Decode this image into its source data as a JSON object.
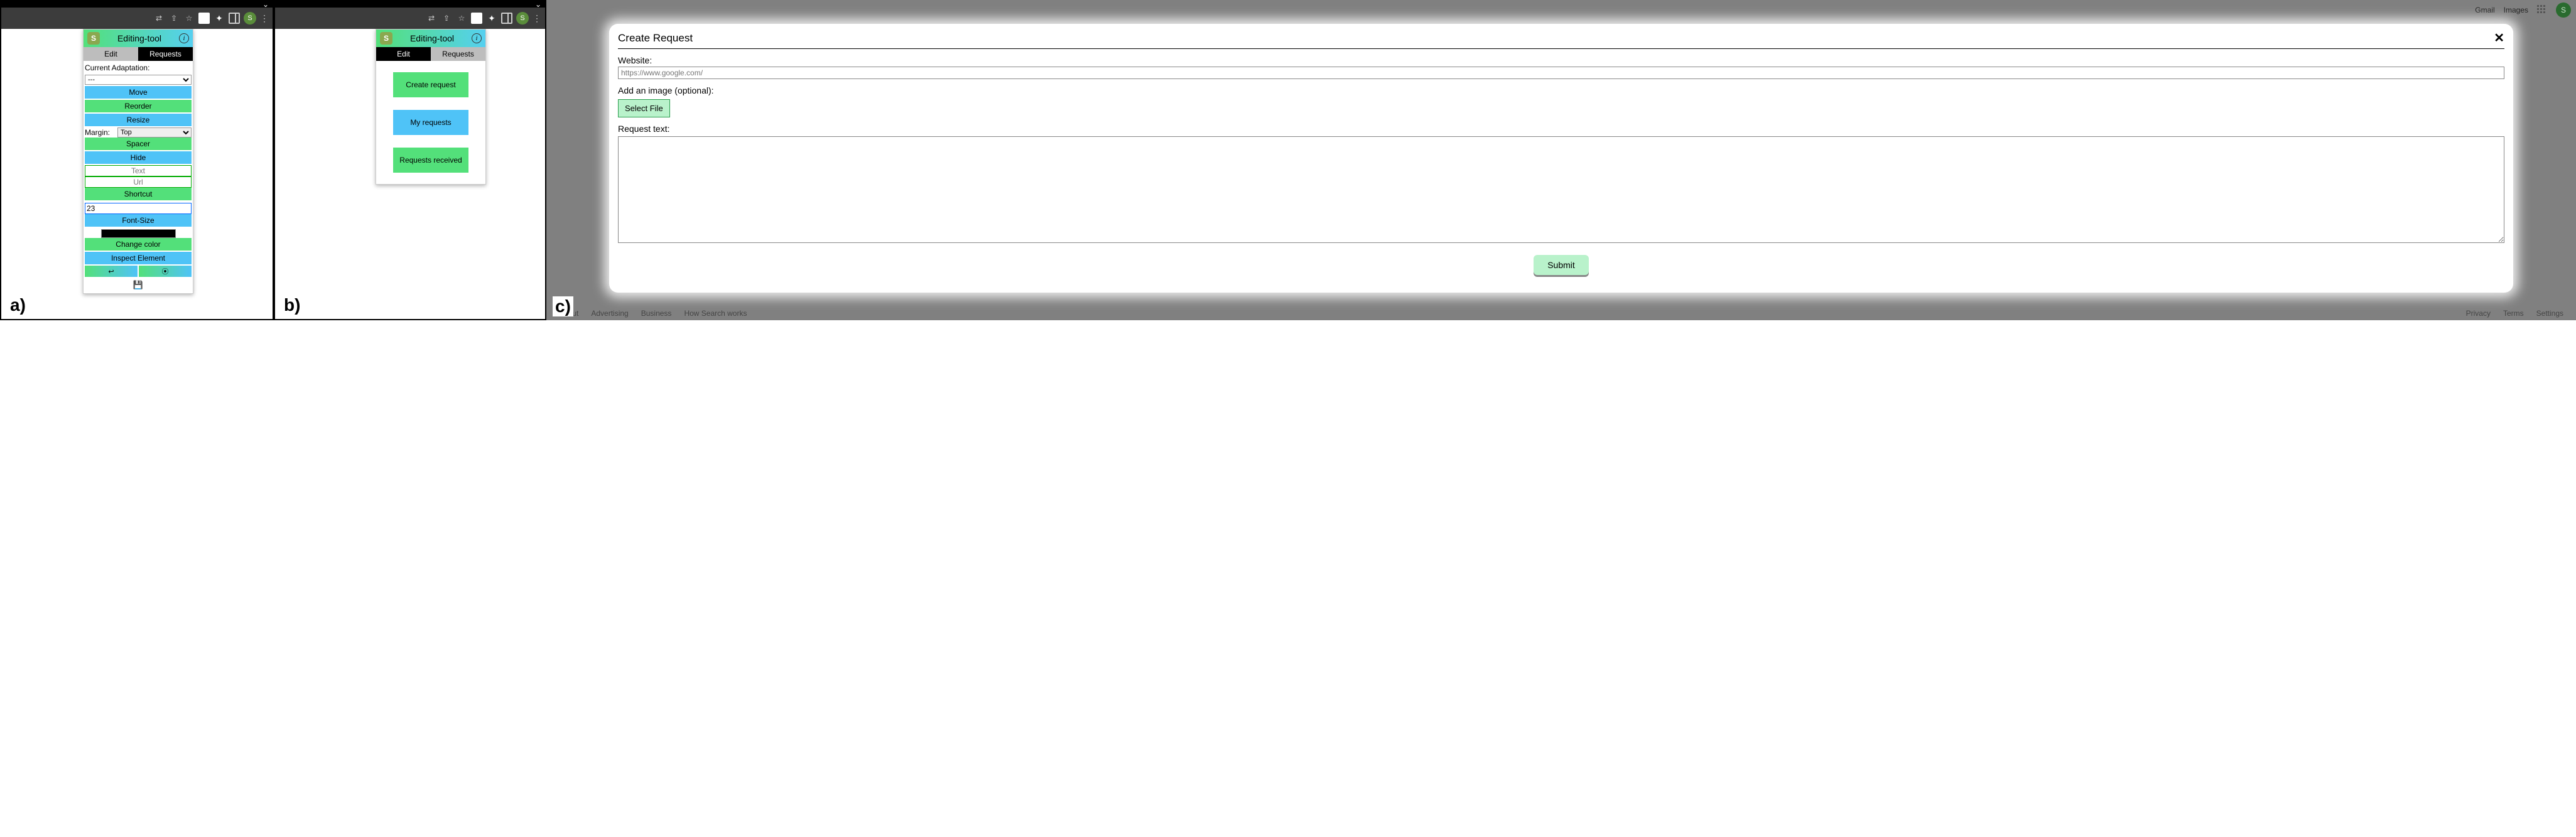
{
  "figure_labels": {
    "a": "a)",
    "b": "b)",
    "c": "c)"
  },
  "chrome": {
    "avatar_letter": "S"
  },
  "extension": {
    "logo_letter": "S",
    "title": "Editing-tool",
    "tabs": {
      "edit": "Edit",
      "requests": "Requests"
    }
  },
  "panel_a": {
    "active_tab": "requests",
    "current_adaptation_label": "Current Adaptation:",
    "current_adaptation_value": "---",
    "buttons": {
      "move": "Move",
      "reorder": "Reorder",
      "resize": "Resize",
      "spacer": "Spacer",
      "hide": "Hide",
      "shortcut": "Shortcut",
      "fontsize": "Font-Size",
      "changecolor": "Change color",
      "inspect": "Inspect Element"
    },
    "margin_label": "Margin:",
    "margin_value": "Top",
    "text_placeholder": "Text",
    "url_placeholder": "Url",
    "fontsize_value": "23",
    "undo_icon": "↩",
    "target_icon": "⦿",
    "save_icon": "💾"
  },
  "panel_b": {
    "active_tab": "edit",
    "buttons": {
      "create": "Create request",
      "my": "My requests",
      "received": "Requests received"
    }
  },
  "panel_c": {
    "topbar": {
      "gmail": "Gmail",
      "images": "Images",
      "avatar": "S"
    },
    "footer_left": [
      "About",
      "Advertising",
      "Business",
      "How Search works"
    ],
    "footer_right": [
      "Privacy",
      "Terms",
      "Settings"
    ],
    "modal": {
      "title": "Create Request",
      "website_label": "Website:",
      "website_placeholder": "https://www.google.com/",
      "image_label": "Add an image (optional):",
      "select_file": "Select File",
      "request_text_label": "Request text:",
      "submit": "Submit"
    }
  }
}
